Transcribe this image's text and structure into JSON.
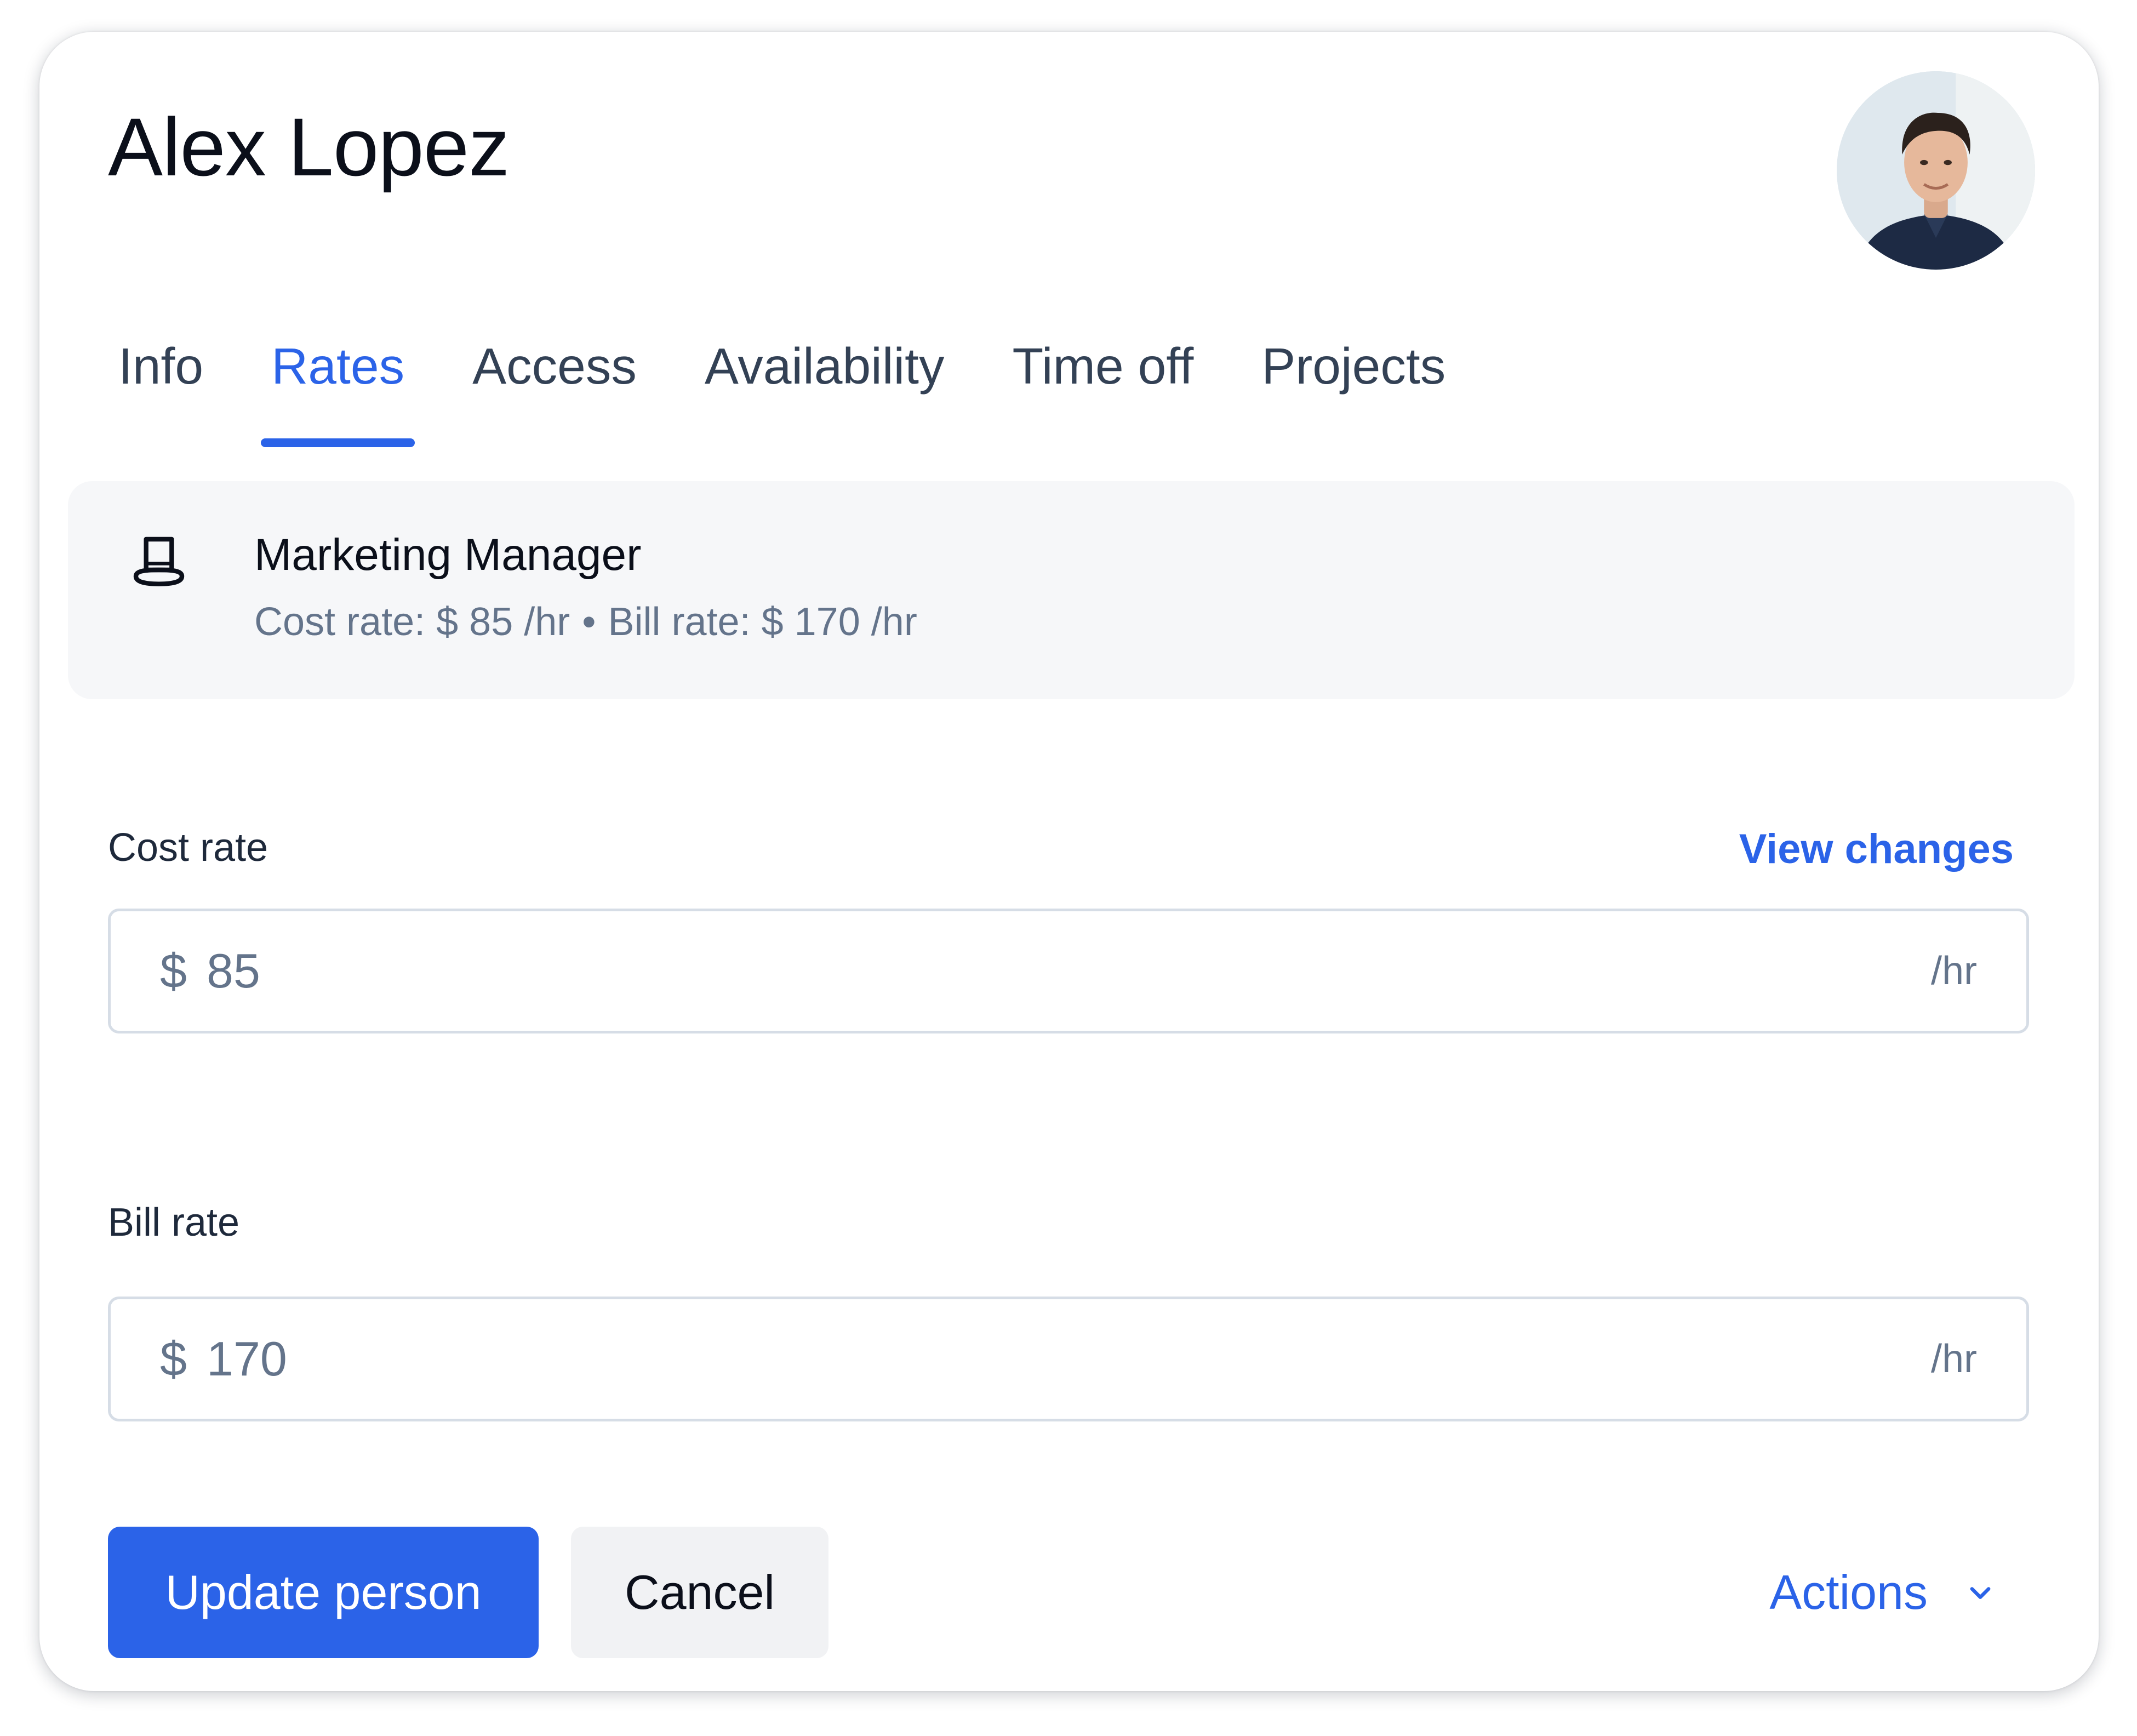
{
  "person": {
    "name": "Alex Lopez"
  },
  "tabs": [
    {
      "label": "Info"
    },
    {
      "label": "Rates"
    },
    {
      "label": "Access"
    },
    {
      "label": "Availability"
    },
    {
      "label": "Time off"
    },
    {
      "label": "Projects"
    }
  ],
  "active_tab": "Rates",
  "role": {
    "icon": "top-hat-icon",
    "title": "Marketing Manager",
    "cost_rate_text": "Cost rate: $ 85 /hr",
    "separator": "•",
    "bill_rate_text": "Bill rate: $ 170 /hr"
  },
  "cost_rate": {
    "label": "Cost rate",
    "link": "View changes",
    "prefix": "$",
    "value": "85",
    "suffix": "/hr"
  },
  "bill_rate": {
    "label": "Bill rate",
    "prefix": "$",
    "value": "170",
    "suffix": "/hr"
  },
  "footer": {
    "update_label": "Update person",
    "cancel_label": "Cancel",
    "actions_label": "Actions",
    "actions_icon": "chevron-down-icon"
  },
  "colors": {
    "accent": "#2b63e8",
    "text_primary": "#0b0f1a",
    "text_muted": "#64748b",
    "card_bg": "#f6f7f9",
    "border": "#d6dde6"
  }
}
